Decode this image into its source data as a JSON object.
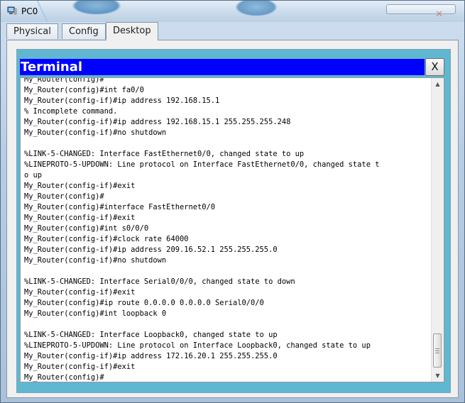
{
  "window": {
    "title": "PC0",
    "icon": "pc-icon"
  },
  "tabs": [
    {
      "label": "Physical",
      "active": false
    },
    {
      "label": "Config",
      "active": false
    },
    {
      "label": "Desktop",
      "active": true
    }
  ],
  "terminal": {
    "title": "Terminal",
    "close_label": "X",
    "lines": [
      "My_Router(config)#",
      "My_Router(config)#int fa0/0",
      "My_Router(config-if)#ip address 192.168.15.1",
      "% Incomplete command.",
      "My_Router(config-if)#ip address 192.168.15.1 255.255.255.248",
      "My_Router(config-if)#no shutdown",
      "",
      "%LINK-5-CHANGED: Interface FastEthernet0/0, changed state to up",
      "%LINEPROTO-5-UPDOWN: Line protocol on Interface FastEthernet0/0, changed state t",
      "o up",
      "My_Router(config-if)#exit",
      "My_Router(config)#",
      "My_Router(config)#interface FastEthernet0/0",
      "My_Router(config-if)#exit",
      "My_Router(config)#int s0/0/0",
      "My_Router(config-if)#clock rate 64000",
      "My_Router(config-if)#ip address 209.16.52.1 255.255.255.0",
      "My_Router(config-if)#no shutdown",
      "",
      "%LINK-5-CHANGED: Interface Serial0/0/0, changed state to down",
      "My_Router(config-if)#exit",
      "My_Router(config)#ip route 0.0.0.0 0.0.0.0 Serial0/0/0",
      "My_Router(config)#int loopback 0",
      "",
      "%LINK-5-CHANGED: Interface Loopback0, changed state to up",
      "%LINEPROTO-5-UPDOWN: Line protocol on Interface Loopback0, changed state to up",
      "My_Router(config-if)#ip address 172.16.20.1 255.255.255.0",
      "My_Router(config-if)#exit",
      "My_Router(config)#"
    ]
  },
  "scrollbar": {
    "up_icon": "arrow-up-icon",
    "down_icon": "arrow-down-icon"
  },
  "colors": {
    "terminal_title_bg": "#0000ff",
    "terminal_frame": "#5fb7d1"
  }
}
